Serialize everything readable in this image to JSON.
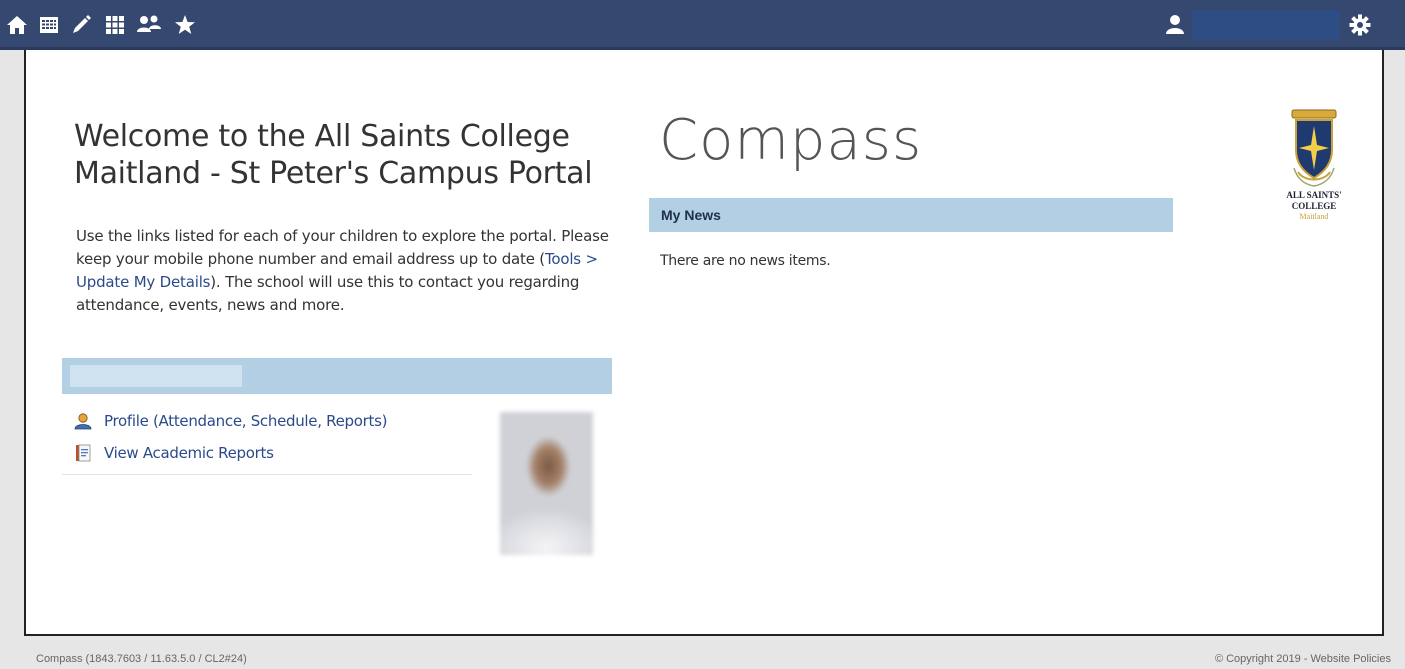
{
  "nav": {
    "icons": [
      "home-icon",
      "calendar-icon",
      "pencil-icon",
      "grid-icon",
      "people-icon",
      "star-icon"
    ],
    "user_icon": "user-icon",
    "settings_icon": "gear-icon",
    "bar_color": "#35486f"
  },
  "welcome": {
    "title": "Welcome to the All Saints College Maitland - St Peter's Campus Portal",
    "intro_before_link": "Use the links listed for each of your children to explore the portal. Please keep your mobile phone number and email address up to date (",
    "intro_link": "Tools > Update My Details",
    "intro_after_link": "). The school will use this to contact you regarding attendance, events, news and more."
  },
  "child": {
    "links": [
      {
        "label": "Profile (Attendance, Schedule, Reports)",
        "icon": "profile-icon"
      },
      {
        "label": "View Academic Reports",
        "icon": "report-book-icon"
      }
    ]
  },
  "brand": {
    "name": "Compass"
  },
  "news": {
    "header": "My News",
    "empty_text": "There are no news items.",
    "header_color": "#b3cfe3"
  },
  "school_logo": {
    "line1": "ALL SAINTS'",
    "line2": "COLLEGE",
    "line3": "Maitland"
  },
  "footer": {
    "version": "Compass (1843.7603 / 11.63.5.0 / CL2#24)",
    "copyright": "© Copyright 2019 - Website Policies"
  }
}
